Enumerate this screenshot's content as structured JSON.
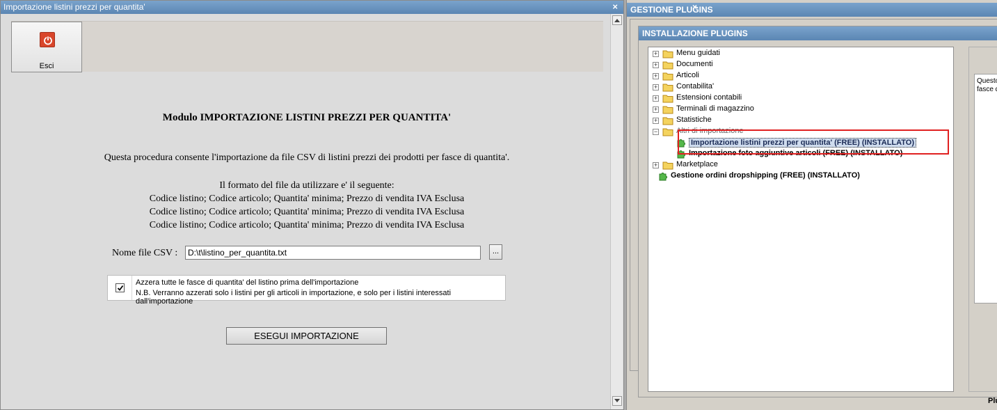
{
  "main_window": {
    "title": "Importazione listini prezzi per quantita'",
    "close": "×"
  },
  "toolbar": {
    "exit_label": "Esci"
  },
  "module": {
    "title": "Modulo IMPORTAZIONE LISTINI PREZZI PER QUANTITA'",
    "description": "Questa procedura consente l'importazione da file CSV di listini prezzi dei prodotti per fasce di quantita'.",
    "format_intro": "Il formato del file da utilizzare e' il seguente:",
    "format_lines": [
      "Codice listino; Codice articolo; Quantita' minima; Prezzo di vendita IVA Esclusa",
      "Codice listino; Codice articolo; Quantita' minima; Prezzo di vendita IVA Esclusa",
      "Codice listino; Codice articolo; Quantita' minima; Prezzo di vendita IVA Esclusa"
    ]
  },
  "csv": {
    "label": "Nome file CSV :",
    "value": "D:\\t\\listino_per_quantita.txt",
    "browse_label": "..."
  },
  "reset_option": {
    "checked": true,
    "line1": "Azzera tutte le fasce di quantita' del listino prima dell'importazione",
    "line2": "N.B. Verranno azzerati solo i listini per gli articoli in importazione, e solo per i listini interessati dall'importazione"
  },
  "run_button": "ESEGUI IMPORTAZIONE",
  "plugin_manager": {
    "title": "GESTIONE PLUGINS",
    "close": "×",
    "install_title": "INSTALLAZIONE PLUGINS",
    "tree": [
      {
        "label": "Menu guidati",
        "expander": "+"
      },
      {
        "label": "Documenti",
        "expander": "+"
      },
      {
        "label": "Articoli",
        "expander": "+"
      },
      {
        "label": "Contabilita'",
        "expander": "+"
      },
      {
        "label": "Estensioni contabili",
        "expander": "+"
      },
      {
        "label": "Terminali di magazzino",
        "expander": "+"
      },
      {
        "label": "Statistiche",
        "expander": "+"
      },
      {
        "label": "Altri di importazione",
        "expander": "−"
      }
    ],
    "sub_items": [
      "Importazione listini prezzi per quantita' (FREE) (INSTALLATO)",
      "Importazione foto aggiuntive articoli (FREE) (INSTALLATO)"
    ],
    "marketplace": {
      "label": "Marketplace",
      "expander": "+"
    },
    "dropshipping": "Gestione ordini dropshipping (FREE) (INSTALLATO)",
    "description_lines": [
      "Questo plu",
      "fasce di q"
    ],
    "plugin_label": "Plugin"
  }
}
